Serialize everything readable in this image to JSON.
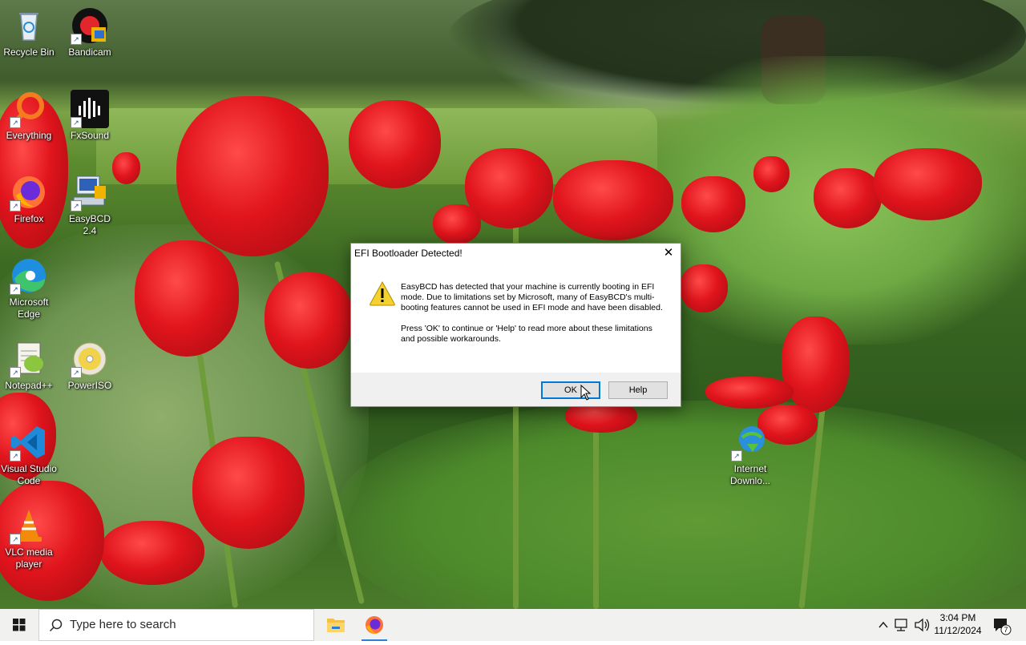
{
  "desktop_icons": [
    {
      "id": "recycle-bin",
      "label": "Recycle Bin",
      "icon": "recycle-bin-icon"
    },
    {
      "id": "bandicam",
      "label": "Bandicam",
      "icon": "bandicam-icon"
    },
    {
      "id": "everything",
      "label": "Everything",
      "icon": "everything-icon"
    },
    {
      "id": "fxsound",
      "label": "FxSound",
      "icon": "fxsound-icon"
    },
    {
      "id": "firefox",
      "label": "Firefox",
      "icon": "firefox-icon"
    },
    {
      "id": "easybcd",
      "label": "EasyBCD 2.4",
      "icon": "easybcd-icon"
    },
    {
      "id": "edge",
      "label": "Microsoft Edge",
      "icon": "edge-icon"
    },
    {
      "id": "notepadpp",
      "label": "Notepad++",
      "icon": "notepadpp-icon"
    },
    {
      "id": "poweriso",
      "label": "PowerISO",
      "icon": "poweriso-icon"
    },
    {
      "id": "vscode",
      "label": "Visual Studio Code",
      "icon": "vscode-icon"
    },
    {
      "id": "vlc",
      "label": "VLC media player",
      "icon": "vlc-icon"
    },
    {
      "id": "idm",
      "label": "Internet Downlo...",
      "icon": "idm-icon"
    }
  ],
  "dialog": {
    "title": "EFI Bootloader Detected!",
    "close_glyph": "✕",
    "message1": "EasyBCD has detected that your machine is currently booting in EFI mode. Due to limitations set by Microsoft, many of EasyBCD's multi-booting features cannot be used in EFI mode and have been disabled.",
    "message2": "Press 'OK' to continue or 'Help' to read more about these limitations and possible workarounds.",
    "ok_label": "OK",
    "help_label": "Help",
    "icon": "warning-icon"
  },
  "taskbar": {
    "search_placeholder": "Type here to search",
    "pinned": [
      "file-explorer-icon",
      "firefox-icon"
    ],
    "time": "3:04 PM",
    "date": "11/12/2024",
    "notification_count": "7"
  },
  "colors": {
    "accent": "#0078d7",
    "taskbar_bg": "#f1f1ef",
    "dialog_footer": "#f0f0f0"
  }
}
